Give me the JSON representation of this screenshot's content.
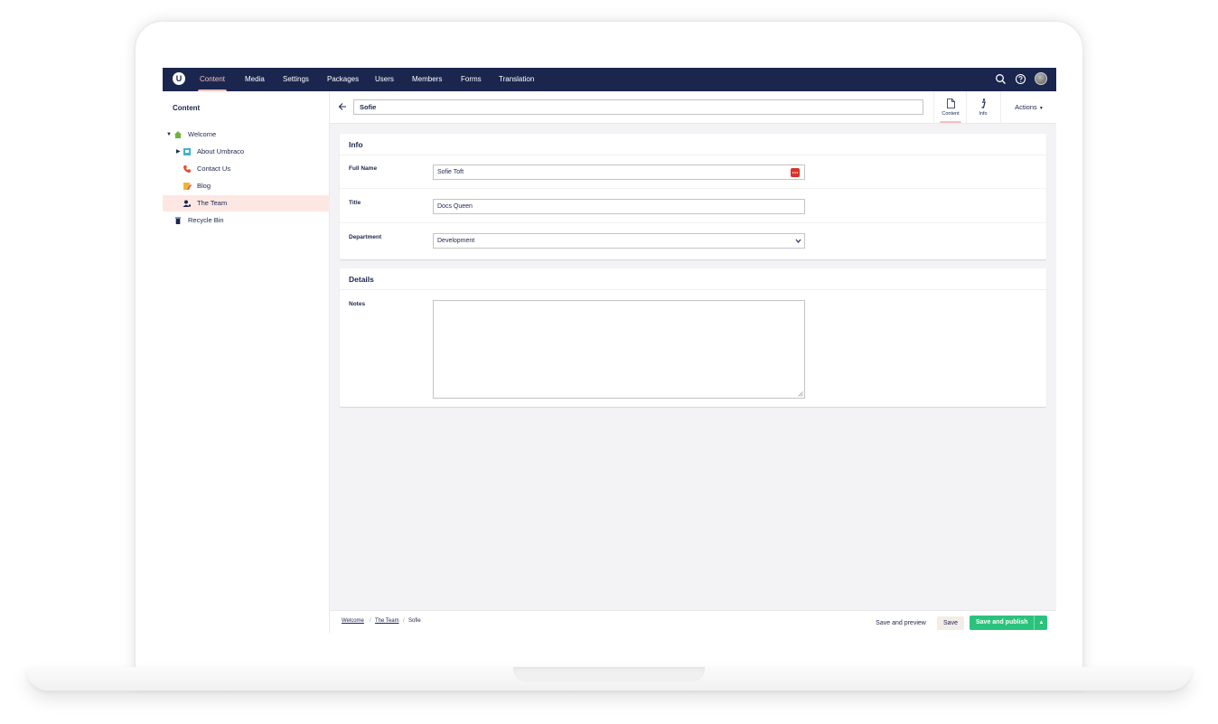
{
  "nav": {
    "items": [
      "Content",
      "Media",
      "Settings",
      "Packages",
      "Users",
      "Members",
      "Forms",
      "Translation"
    ],
    "active": "Content",
    "logo_letter": "U"
  },
  "sidebar": {
    "title": "Content",
    "tree": [
      {
        "label": "Welcome",
        "icon": "home-icon"
      },
      {
        "label": "About Umbraco",
        "icon": "document-icon"
      },
      {
        "label": "Contact Us",
        "icon": "phone-icon"
      },
      {
        "label": "Blog",
        "icon": "blog-icon"
      },
      {
        "label": "The Team",
        "icon": "team-icon",
        "selected": true
      },
      {
        "label": "Recycle Bin",
        "icon": "trash-icon"
      }
    ]
  },
  "editor": {
    "name_value": "Sofie",
    "apps": [
      {
        "label": "Content",
        "icon": "document-icon",
        "active": true
      },
      {
        "label": "Info",
        "icon": "info-icon"
      }
    ],
    "actions_label": "Actions"
  },
  "info_panel": {
    "title": "Info",
    "full_name": {
      "label": "Full Name",
      "value": "Sofie Toft"
    },
    "title_field": {
      "label": "Title",
      "value": "Docs Queen"
    },
    "department": {
      "label": "Department",
      "value": "Development"
    }
  },
  "details_panel": {
    "title": "Details",
    "notes": {
      "label": "Notes",
      "value": ""
    }
  },
  "footer": {
    "breadcrumb": [
      "Welcome",
      "The Team",
      "Sofie"
    ],
    "separator": "/",
    "save_preview": "Save and preview",
    "save": "Save",
    "save_publish": "Save and publish"
  },
  "colors": {
    "header": "#1b264f",
    "accent": "#f5c1bc",
    "publish": "#2bc37c",
    "selected_row": "#fde7e3"
  }
}
